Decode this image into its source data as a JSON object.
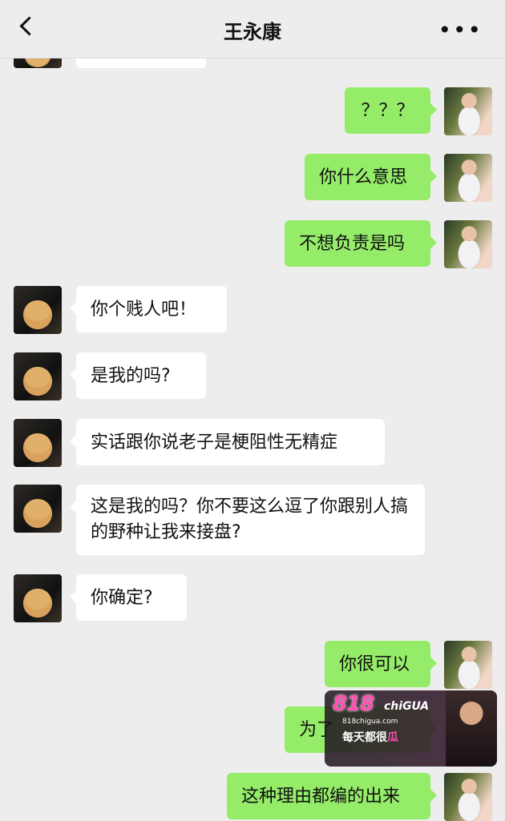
{
  "header": {
    "title": "王永康"
  },
  "messages": [
    {
      "side": "right",
      "text": "？？？"
    },
    {
      "side": "right",
      "text": "你什么意思"
    },
    {
      "side": "right",
      "text": "不想负责是吗"
    },
    {
      "side": "left",
      "text": "你个贱人吧！"
    },
    {
      "side": "left",
      "text": "是我的吗?"
    },
    {
      "side": "left",
      "text": "实话跟你说老子是梗阻性无精症"
    },
    {
      "side": "left",
      "text": "这是我的吗？你不要这么逗了你跟别人搞的野种让我来接盘?"
    },
    {
      "side": "left",
      "text": "你确定?"
    },
    {
      "side": "right",
      "text": "你很可以"
    },
    {
      "side": "right",
      "text": "为了"
    },
    {
      "side": "right",
      "text": "这种理由都编的出来"
    }
  ],
  "watermark": {
    "logo": "818",
    "brand": "chiGUA",
    "url": "818chigua.com",
    "slogan_a": "每天都很",
    "slogan_b": "瓜"
  },
  "colors": {
    "background": "#ededed",
    "bubble_sent": "#95ec69",
    "bubble_received": "#ffffff"
  }
}
